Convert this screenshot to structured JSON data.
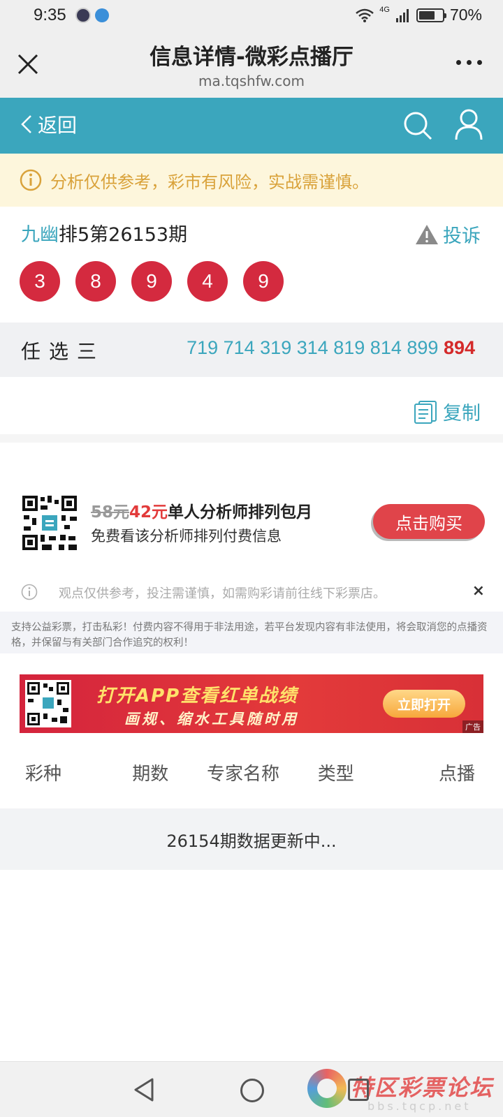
{
  "status": {
    "time": "9:35",
    "network": "4G",
    "battery_text": "70%",
    "battery_level": 0.7
  },
  "browser": {
    "title": "信息详情-微彩点播厅",
    "url": "ma.tqshfw.com"
  },
  "header": {
    "back_label": "返回"
  },
  "warning": {
    "text": "分析仅供参考，彩市有风险，实战需谨慎。"
  },
  "issue": {
    "name": "九幽",
    "title": "排5第26153期",
    "report_label": "投诉",
    "balls": [
      "3",
      "8",
      "9",
      "4",
      "9"
    ]
  },
  "pick": {
    "label": "任选三",
    "numbers": "719 714 319 314 819 814 899",
    "hit": "894",
    "copy_label": "复制"
  },
  "promo": {
    "old_price": "58元",
    "new_price": "42元",
    "title": "单人分析师排列包月",
    "subtitle": "免费看该分析师排列付费信息",
    "buy_label": "点击购买"
  },
  "notice": {
    "text": "观点仅供参考，投注需谨慎，如需购彩请前往线下彩票店。",
    "close": "×"
  },
  "disclaimer": "支持公益彩票，打击私彩！付费内容不得用于非法用途，若平台发现内容有非法使用，将会取消您的点播资格，并保留与有关部门合作追究的权利！",
  "ad": {
    "line1": "打开APP查看红单战绩",
    "line2": "画规、缩水工具随时用",
    "open_label": "立即打开",
    "tag": "广告"
  },
  "table": {
    "headers": [
      "彩种",
      "期数",
      "专家名称",
      "类型",
      "点播"
    ],
    "status": "26154期数据更新中..."
  },
  "watermark": {
    "text": "特区彩票论坛",
    "sub": "bbs.tqcp.net"
  },
  "colors": {
    "accent": "#3ba6bd",
    "ball": "#d42a3f",
    "warning_bg": "#fdf6dc",
    "warning_text": "#d9a23a"
  }
}
